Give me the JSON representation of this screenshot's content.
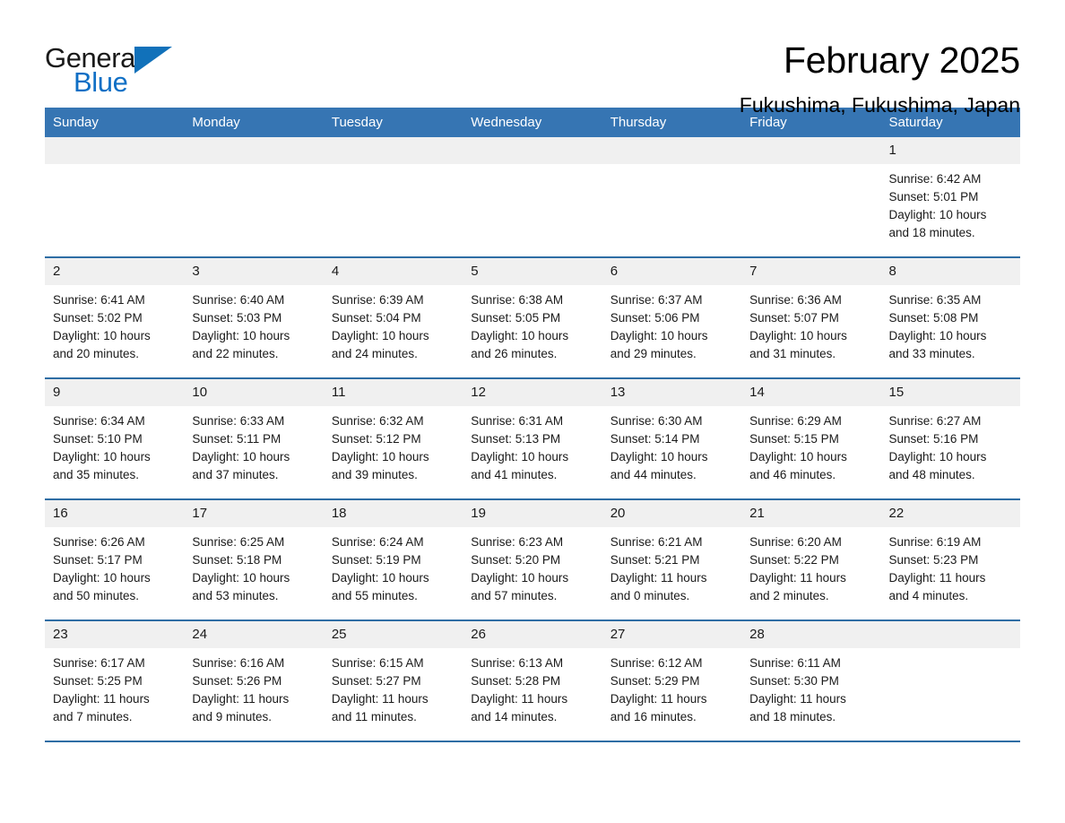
{
  "brand": {
    "name_part1": "General",
    "name_part2": "Blue",
    "accent_color": "#1171ba"
  },
  "header": {
    "title": "February 2025",
    "subtitle": "Fukushima, Fukushima, Japan"
  },
  "theme": {
    "header_bg": "#3675b3",
    "row_border": "#2e6da4",
    "daynum_bg": "#f0f0f0"
  },
  "weekdays": [
    "Sunday",
    "Monday",
    "Tuesday",
    "Wednesday",
    "Thursday",
    "Friday",
    "Saturday"
  ],
  "weeks": [
    [
      {
        "day": "",
        "sunrise": "",
        "sunset": "",
        "daylight": "",
        "daylight2": "",
        "blank": true
      },
      {
        "day": "",
        "sunrise": "",
        "sunset": "",
        "daylight": "",
        "daylight2": "",
        "blank": true
      },
      {
        "day": "",
        "sunrise": "",
        "sunset": "",
        "daylight": "",
        "daylight2": "",
        "blank": true
      },
      {
        "day": "",
        "sunrise": "",
        "sunset": "",
        "daylight": "",
        "daylight2": "",
        "blank": true
      },
      {
        "day": "",
        "sunrise": "",
        "sunset": "",
        "daylight": "",
        "daylight2": "",
        "blank": true
      },
      {
        "day": "",
        "sunrise": "",
        "sunset": "",
        "daylight": "",
        "daylight2": "",
        "blank": true
      },
      {
        "day": "1",
        "sunrise": "Sunrise: 6:42 AM",
        "sunset": "Sunset: 5:01 PM",
        "daylight": "Daylight: 10 hours",
        "daylight2": "and 18 minutes.",
        "blank": false
      }
    ],
    [
      {
        "day": "2",
        "sunrise": "Sunrise: 6:41 AM",
        "sunset": "Sunset: 5:02 PM",
        "daylight": "Daylight: 10 hours",
        "daylight2": "and 20 minutes.",
        "blank": false
      },
      {
        "day": "3",
        "sunrise": "Sunrise: 6:40 AM",
        "sunset": "Sunset: 5:03 PM",
        "daylight": "Daylight: 10 hours",
        "daylight2": "and 22 minutes.",
        "blank": false
      },
      {
        "day": "4",
        "sunrise": "Sunrise: 6:39 AM",
        "sunset": "Sunset: 5:04 PM",
        "daylight": "Daylight: 10 hours",
        "daylight2": "and 24 minutes.",
        "blank": false
      },
      {
        "day": "5",
        "sunrise": "Sunrise: 6:38 AM",
        "sunset": "Sunset: 5:05 PM",
        "daylight": "Daylight: 10 hours",
        "daylight2": "and 26 minutes.",
        "blank": false
      },
      {
        "day": "6",
        "sunrise": "Sunrise: 6:37 AM",
        "sunset": "Sunset: 5:06 PM",
        "daylight": "Daylight: 10 hours",
        "daylight2": "and 29 minutes.",
        "blank": false
      },
      {
        "day": "7",
        "sunrise": "Sunrise: 6:36 AM",
        "sunset": "Sunset: 5:07 PM",
        "daylight": "Daylight: 10 hours",
        "daylight2": "and 31 minutes.",
        "blank": false
      },
      {
        "day": "8",
        "sunrise": "Sunrise: 6:35 AM",
        "sunset": "Sunset: 5:08 PM",
        "daylight": "Daylight: 10 hours",
        "daylight2": "and 33 minutes.",
        "blank": false
      }
    ],
    [
      {
        "day": "9",
        "sunrise": "Sunrise: 6:34 AM",
        "sunset": "Sunset: 5:10 PM",
        "daylight": "Daylight: 10 hours",
        "daylight2": "and 35 minutes.",
        "blank": false
      },
      {
        "day": "10",
        "sunrise": "Sunrise: 6:33 AM",
        "sunset": "Sunset: 5:11 PM",
        "daylight": "Daylight: 10 hours",
        "daylight2": "and 37 minutes.",
        "blank": false
      },
      {
        "day": "11",
        "sunrise": "Sunrise: 6:32 AM",
        "sunset": "Sunset: 5:12 PM",
        "daylight": "Daylight: 10 hours",
        "daylight2": "and 39 minutes.",
        "blank": false
      },
      {
        "day": "12",
        "sunrise": "Sunrise: 6:31 AM",
        "sunset": "Sunset: 5:13 PM",
        "daylight": "Daylight: 10 hours",
        "daylight2": "and 41 minutes.",
        "blank": false
      },
      {
        "day": "13",
        "sunrise": "Sunrise: 6:30 AM",
        "sunset": "Sunset: 5:14 PM",
        "daylight": "Daylight: 10 hours",
        "daylight2": "and 44 minutes.",
        "blank": false
      },
      {
        "day": "14",
        "sunrise": "Sunrise: 6:29 AM",
        "sunset": "Sunset: 5:15 PM",
        "daylight": "Daylight: 10 hours",
        "daylight2": "and 46 minutes.",
        "blank": false
      },
      {
        "day": "15",
        "sunrise": "Sunrise: 6:27 AM",
        "sunset": "Sunset: 5:16 PM",
        "daylight": "Daylight: 10 hours",
        "daylight2": "and 48 minutes.",
        "blank": false
      }
    ],
    [
      {
        "day": "16",
        "sunrise": "Sunrise: 6:26 AM",
        "sunset": "Sunset: 5:17 PM",
        "daylight": "Daylight: 10 hours",
        "daylight2": "and 50 minutes.",
        "blank": false
      },
      {
        "day": "17",
        "sunrise": "Sunrise: 6:25 AM",
        "sunset": "Sunset: 5:18 PM",
        "daylight": "Daylight: 10 hours",
        "daylight2": "and 53 minutes.",
        "blank": false
      },
      {
        "day": "18",
        "sunrise": "Sunrise: 6:24 AM",
        "sunset": "Sunset: 5:19 PM",
        "daylight": "Daylight: 10 hours",
        "daylight2": "and 55 minutes.",
        "blank": false
      },
      {
        "day": "19",
        "sunrise": "Sunrise: 6:23 AM",
        "sunset": "Sunset: 5:20 PM",
        "daylight": "Daylight: 10 hours",
        "daylight2": "and 57 minutes.",
        "blank": false
      },
      {
        "day": "20",
        "sunrise": "Sunrise: 6:21 AM",
        "sunset": "Sunset: 5:21 PM",
        "daylight": "Daylight: 11 hours",
        "daylight2": "and 0 minutes.",
        "blank": false
      },
      {
        "day": "21",
        "sunrise": "Sunrise: 6:20 AM",
        "sunset": "Sunset: 5:22 PM",
        "daylight": "Daylight: 11 hours",
        "daylight2": "and 2 minutes.",
        "blank": false
      },
      {
        "day": "22",
        "sunrise": "Sunrise: 6:19 AM",
        "sunset": "Sunset: 5:23 PM",
        "daylight": "Daylight: 11 hours",
        "daylight2": "and 4 minutes.",
        "blank": false
      }
    ],
    [
      {
        "day": "23",
        "sunrise": "Sunrise: 6:17 AM",
        "sunset": "Sunset: 5:25 PM",
        "daylight": "Daylight: 11 hours",
        "daylight2": "and 7 minutes.",
        "blank": false
      },
      {
        "day": "24",
        "sunrise": "Sunrise: 6:16 AM",
        "sunset": "Sunset: 5:26 PM",
        "daylight": "Daylight: 11 hours",
        "daylight2": "and 9 minutes.",
        "blank": false
      },
      {
        "day": "25",
        "sunrise": "Sunrise: 6:15 AM",
        "sunset": "Sunset: 5:27 PM",
        "daylight": "Daylight: 11 hours",
        "daylight2": "and 11 minutes.",
        "blank": false
      },
      {
        "day": "26",
        "sunrise": "Sunrise: 6:13 AM",
        "sunset": "Sunset: 5:28 PM",
        "daylight": "Daylight: 11 hours",
        "daylight2": "and 14 minutes.",
        "blank": false
      },
      {
        "day": "27",
        "sunrise": "Sunrise: 6:12 AM",
        "sunset": "Sunset: 5:29 PM",
        "daylight": "Daylight: 11 hours",
        "daylight2": "and 16 minutes.",
        "blank": false
      },
      {
        "day": "28",
        "sunrise": "Sunrise: 6:11 AM",
        "sunset": "Sunset: 5:30 PM",
        "daylight": "Daylight: 11 hours",
        "daylight2": "and 18 minutes.",
        "blank": false
      },
      {
        "day": "",
        "sunrise": "",
        "sunset": "",
        "daylight": "",
        "daylight2": "",
        "blank": true
      }
    ]
  ]
}
